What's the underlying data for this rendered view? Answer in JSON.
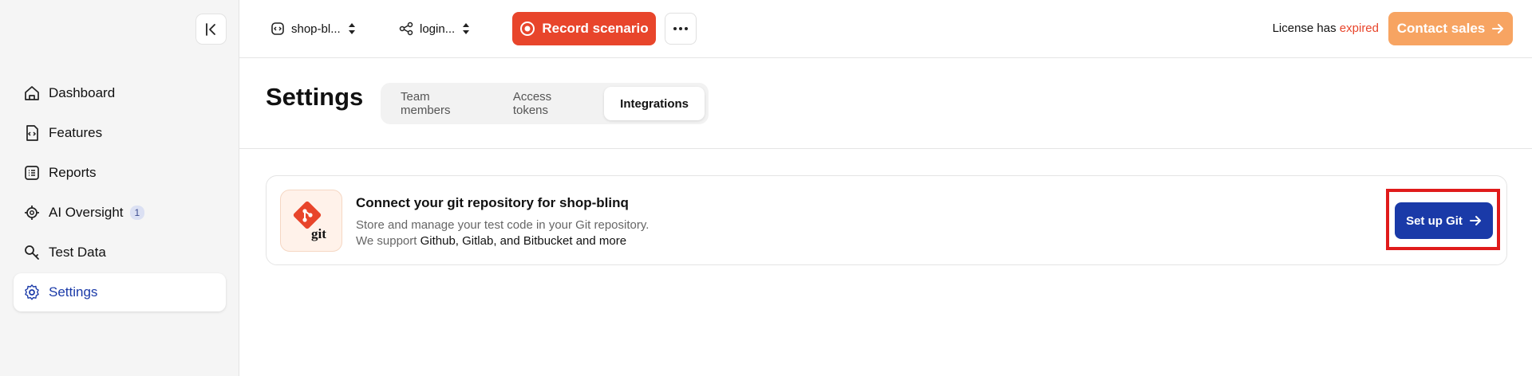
{
  "sidebar": {
    "items": [
      {
        "label": "Dashboard",
        "icon": "home-icon"
      },
      {
        "label": "Features",
        "icon": "feature-file-icon"
      },
      {
        "label": "Reports",
        "icon": "list-icon"
      },
      {
        "label": "AI Oversight",
        "icon": "ai-chip-icon",
        "badge": "1"
      },
      {
        "label": "Test Data",
        "icon": "search-key-icon"
      },
      {
        "label": "Settings",
        "icon": "gear-icon",
        "active": true
      }
    ]
  },
  "topbar": {
    "project_selector": "shop-bl...",
    "scenario_selector": "login...",
    "record_label": "Record scenario",
    "license_prefix": "License has",
    "license_status": "expired",
    "contact_label": "Contact sales"
  },
  "page": {
    "title": "Settings",
    "tabs": [
      {
        "label": "Team members"
      },
      {
        "label": "Access tokens"
      },
      {
        "label": "Integrations",
        "active": true
      }
    ]
  },
  "git_card": {
    "logo_text": "git",
    "title": "Connect your git repository for shop-blinq",
    "desc_line1": "Store and manage your test code in your Git repository.",
    "desc_line2_prefix": "We support",
    "desc_line2_providers": "Github, Gitlab, and Bitbucket and more",
    "button_label": "Set up Git"
  },
  "colors": {
    "accent_blue": "#1a3aa8",
    "record_red": "#e8452b",
    "contact_orange": "#f7a462",
    "highlight_red": "#e01b1b"
  }
}
